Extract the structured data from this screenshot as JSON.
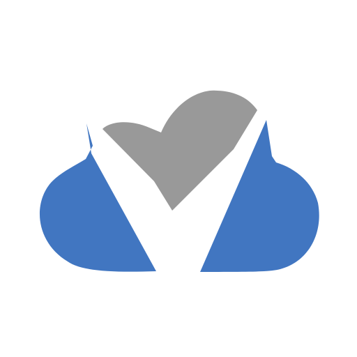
{
  "logo": {
    "icon": "cloud-check-logo",
    "colors": {
      "cloud_blue": "#4176c1",
      "check_gray": "#999999",
      "background": "#ffffff"
    }
  }
}
